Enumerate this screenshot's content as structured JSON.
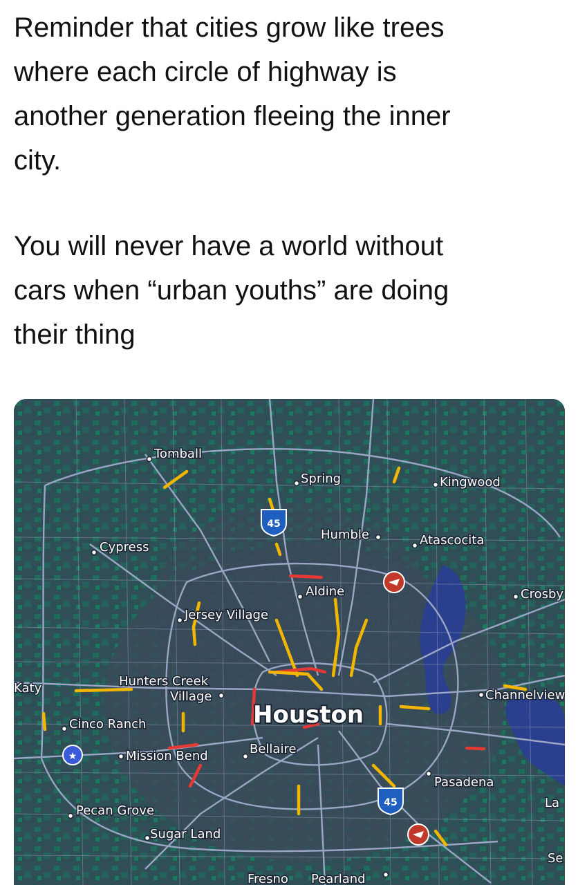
{
  "post": {
    "paragraph_1": "Reminder that cities grow like trees\nwhere each circle of highway is\nanother generation fleeing the inner\ncity.",
    "paragraph_2": "You will never have a world without\ncars when “urban youths” are doing\ntheir thing"
  },
  "map": {
    "central_city": "Houston",
    "places": {
      "tomball": "Tomball",
      "spring": "Spring",
      "kingwood": "Kingwood",
      "humble": "Humble",
      "atascocita": "Atascocita",
      "cypress": "Cypress",
      "aldine": "Aldine",
      "crosby": "Crosby",
      "jersey_village": "Jersey Village",
      "katy": "Katy",
      "hunters_creek_line1": "Hunters Creek",
      "hunters_creek_line2": "Village",
      "channelview": "Channelview",
      "cinco_ranch": "Cinco Ranch",
      "mission_bend": "Mission Bend",
      "bellaire": "Bellaire",
      "pasadena": "Pasadena",
      "la": "La",
      "pecan_grove": "Pecan Grove",
      "sugar_land": "Sugar Land",
      "fresno": "Fresno",
      "pearland": "Pearland",
      "se": "Se"
    },
    "shields": {
      "i45_north": "45",
      "i45_south": "45"
    },
    "colors": {
      "vegetation": "#1f6b5c",
      "urban": "#3a4a5a",
      "water": "#2b3f8f",
      "traffic_slow": "#f2b600",
      "traffic_heavy": "#e53935",
      "highway": "#9aa6c4"
    }
  }
}
